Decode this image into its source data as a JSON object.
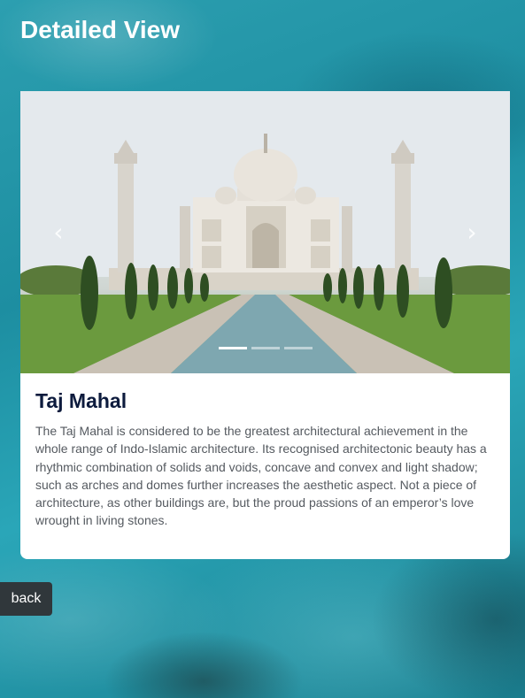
{
  "header": {
    "title": "Detailed View"
  },
  "carousel": {
    "prev_icon": "chevron-left-icon",
    "next_icon": "chevron-right-icon",
    "prev_glyph": "‹",
    "next_glyph": "›",
    "slide_count": 3,
    "active_index": 0
  },
  "card": {
    "title": "Taj Mahal",
    "description": "The Taj Mahal is considered to be the greatest architectural achievement in the whole range of Indo-Islamic architecture. Its recognised architectonic beauty has a rhythmic combination of solids and voids, concave and convex and light shadow; such as arches and domes further increases the aesthetic aspect. Not a piece of architecture, as other buildings are, but the proud passions of an emperor’s love wrought in living stones."
  },
  "footer": {
    "back_label": "back"
  },
  "colors": {
    "title_text": "#0d1b3d",
    "back_button_bg": "#30373b",
    "background": "#1d8ea1"
  }
}
